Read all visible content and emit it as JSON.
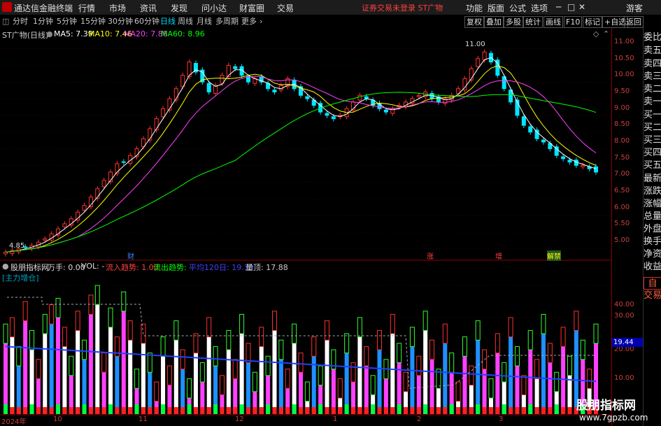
{
  "titlebar": {
    "app_title": "通达信金融终端",
    "menus": [
      "行情",
      "市场",
      "资讯",
      "发现",
      "问小达",
      "财富圈",
      "交易"
    ],
    "warning": "证券交易未登录  ST广物",
    "right_menus": [
      "功能",
      "版面",
      "公式",
      "选项"
    ],
    "guest": "游客",
    "window_controls": [
      "─",
      "□",
      "✕"
    ]
  },
  "toolbar": {
    "periods": [
      "分时",
      "1分钟",
      "5分钟",
      "15分钟",
      "30分钟",
      "60分钟",
      "日线",
      "周线",
      "月线",
      "多周期",
      "更多"
    ],
    "active_period": "日线",
    "right_buttons": [
      "复权",
      "叠加",
      "多股",
      "统计",
      "画线",
      "F10",
      "标记",
      "+自选",
      "返回"
    ]
  },
  "main_legend": {
    "stock": "ST广物(日线)",
    "ma5": "MA5: 7.39",
    "ma10": "MA10: 7.46",
    "ma20": "MA20: 7.88",
    "ma60": "MA60: 8.96"
  },
  "price_axis": [
    "11.00",
    "10.50",
    "10.00",
    "9.50",
    "9.00",
    "8.50",
    "8.00",
    "7.50",
    "7.00",
    "6.50",
    "6.00",
    "5.50",
    "5.00"
  ],
  "annotations": {
    "high": "11.00",
    "low": "4.85"
  },
  "events": [
    {
      "label": "财",
      "color": "#4080ff"
    },
    {
      "label": "涨",
      "color": "#ff4040"
    },
    {
      "label": "增",
      "color": "#ff4040"
    },
    {
      "label": "解禁",
      "color": "#ffff00"
    }
  ],
  "indicator_legend": {
    "name": "股朋指标网",
    "wanshou": "万手: 0.00",
    "vol": "VOL: -",
    "inflow": "流入趋势: 1.00",
    "outflow": "流出趋势: -",
    "avg120": "平均120日: 19.30",
    "peak": "量顶: 17.88"
  },
  "indicator_tag": "[主力增仓]",
  "indicator_axis": [
    "40.00",
    "30.00",
    "20.00",
    "10.00"
  ],
  "indicator_current": "19.44",
  "sidemenu": [
    "委比",
    "卖五",
    "卖四",
    "卖三",
    "卖二",
    "卖一",
    "买一",
    "买二",
    "买三",
    "买四",
    "买五",
    "最新",
    "涨跌",
    "涨幅",
    "总量",
    "外盘",
    "换手",
    "净资",
    "收益"
  ],
  "sidemenu_bottom": [
    "自动",
    "交易"
  ],
  "date_axis": [
    "2024年",
    "10",
    "11",
    "12",
    "1",
    "2",
    "3"
  ],
  "watermark": {
    "line1": "股朋指标网",
    "line2": "www.7gpzb.com"
  },
  "colors": {
    "up": "#ff3030",
    "down": "#00e5ff",
    "ma5": "#ffffff",
    "ma10": "#ffff00",
    "ma20": "#ff40ff",
    "ma60": "#00ff00"
  },
  "chart_data": {
    "type": "candlestick",
    "x_labels": [
      "2024年",
      "10",
      "11",
      "12",
      "1",
      "2",
      "3"
    ],
    "price_range": [
      4.85,
      11.0
    ],
    "close": [
      4.9,
      4.95,
      5.0,
      5.05,
      5.1,
      5.2,
      5.3,
      5.45,
      5.6,
      5.75,
      5.9,
      6.1,
      6.3,
      6.55,
      6.8,
      7.05,
      7.3,
      7.55,
      7.6,
      7.8,
      8.0,
      8.3,
      8.6,
      8.9,
      9.2,
      9.5,
      9.8,
      10.2,
      10.6,
      10.3,
      10.0,
      9.7,
      9.9,
      10.2,
      10.5,
      10.4,
      10.2,
      10.0,
      10.1,
      10.0,
      9.8,
      9.7,
      9.9,
      10.1,
      9.8,
      9.6,
      9.5,
      9.3,
      9.1,
      9.0,
      8.9,
      9.0,
      9.2,
      9.4,
      9.6,
      9.5,
      9.3,
      9.2,
      9.1,
      9.2,
      9.3,
      9.4,
      9.5,
      9.6,
      9.7,
      9.5,
      9.4,
      9.5,
      9.6,
      9.8,
      10.1,
      10.4,
      10.7,
      10.9,
      10.6,
      10.2,
      9.8,
      9.4,
      9.0,
      8.7,
      8.5,
      8.3,
      8.2,
      8.0,
      7.8,
      7.7,
      7.6,
      7.5,
      7.5,
      7.4,
      7.3
    ],
    "indicator_range": [
      0,
      45
    ],
    "ma_series": [
      "MA5",
      "MA10",
      "MA20",
      "MA60"
    ]
  }
}
